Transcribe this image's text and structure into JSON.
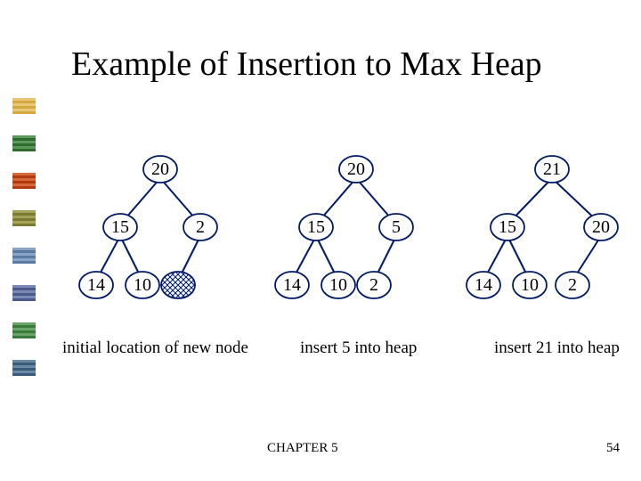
{
  "title": "Example of Insertion to Max Heap",
  "trees": [
    {
      "caption": "initial location of new node",
      "nodes": {
        "root": "20",
        "l": "15",
        "r": "2",
        "ll": "14",
        "lr": "10",
        "rl_placeholder": true
      }
    },
    {
      "caption": "insert 5 into heap",
      "nodes": {
        "root": "20",
        "l": "15",
        "r": "5",
        "ll": "14",
        "lr": "10",
        "rl": "2"
      }
    },
    {
      "caption": "insert 21 into heap",
      "nodes": {
        "root": "21",
        "l": "15",
        "r": "20",
        "ll": "14",
        "lr": "10",
        "rl": "2"
      }
    }
  ],
  "footer": {
    "chapter": "CHAPTER 5",
    "page": "54"
  },
  "decor_colors": [
    "#d4a942",
    "#2e6b2e",
    "#b33a0f",
    "#7a7a33",
    "#5a7aa3",
    "#4a5a8a",
    "#3a7a3a",
    "#3a5a7a"
  ]
}
